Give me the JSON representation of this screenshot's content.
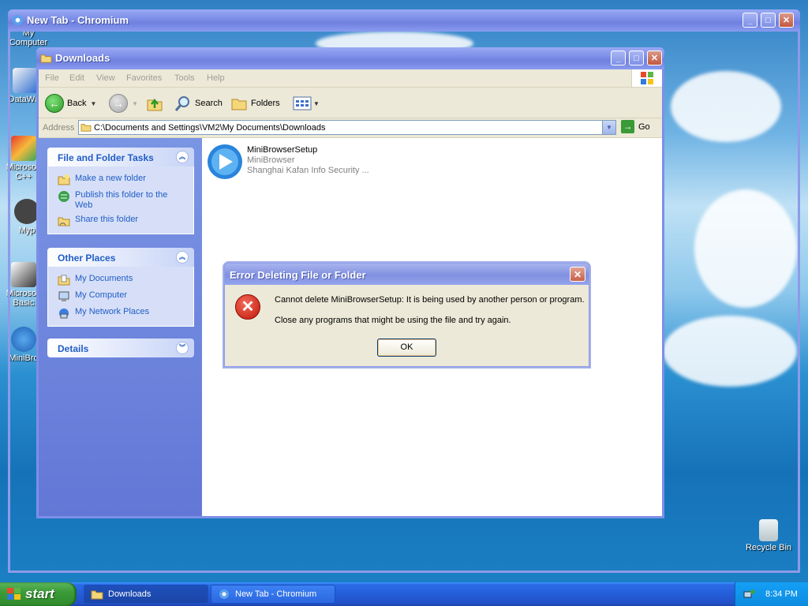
{
  "desktop": {
    "icons": [
      {
        "label": "My Computer"
      },
      {
        "label": "DataWar"
      },
      {
        "label": "Microsoft C++"
      },
      {
        "label": "Myp"
      },
      {
        "label": "Microsoft Basic"
      },
      {
        "label": "MiniBro"
      },
      {
        "label": "Recycle Bin"
      }
    ]
  },
  "chromium_window": {
    "title": "New Tab - Chromium"
  },
  "explorer": {
    "title": "Downloads",
    "menu": [
      "File",
      "Edit",
      "View",
      "Favorites",
      "Tools",
      "Help"
    ],
    "toolbar": {
      "back": "Back",
      "search": "Search",
      "folders": "Folders"
    },
    "address": {
      "label": "Address",
      "value": "C:\\Documents and Settings\\VM2\\My Documents\\Downloads",
      "go": "Go"
    },
    "task_panels": {
      "file_folder": {
        "title": "File and Folder Tasks",
        "items": [
          "Make a new folder",
          "Publish this folder to the Web",
          "Share this folder"
        ]
      },
      "other_places": {
        "title": "Other Places",
        "items": [
          "My Documents",
          "My Computer",
          "My Network Places"
        ]
      },
      "details": {
        "title": "Details"
      }
    },
    "files": [
      {
        "name": "MiniBrowserSetup",
        "description": "MiniBrowser",
        "company": "Shanghai Kafan Info Security ..."
      }
    ]
  },
  "dialog": {
    "title": "Error Deleting File or Folder",
    "message": "Cannot delete MiniBrowserSetup: It is being used by another person or program.",
    "hint": "Close any programs that might be using the file and try again.",
    "ok": "OK"
  },
  "taskbar": {
    "start": "start",
    "buttons": [
      {
        "label": "Downloads"
      },
      {
        "label": "New Tab - Chromium"
      }
    ],
    "clock": "8:34 PM"
  },
  "colors": {
    "xp_link": "#215dc6",
    "title_bar": "#7d8fe8",
    "taskbar": "#245dd8",
    "start_green": "#3c9c38"
  }
}
